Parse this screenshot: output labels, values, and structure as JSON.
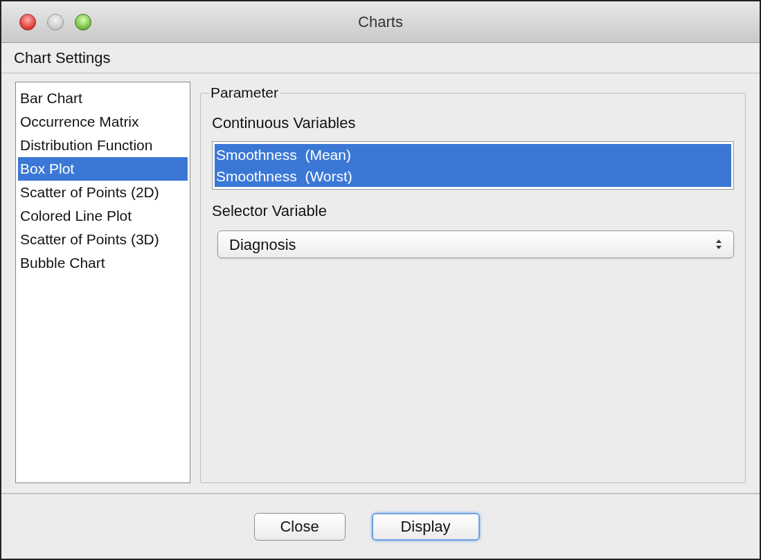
{
  "window": {
    "title": "Charts"
  },
  "header": "Chart Settings",
  "chart_types": [
    {
      "label": "Bar Chart",
      "selected": false
    },
    {
      "label": "Occurrence Matrix",
      "selected": false
    },
    {
      "label": "Distribution Function",
      "selected": false
    },
    {
      "label": "Box Plot",
      "selected": true
    },
    {
      "label": "Scatter of Points (2D)",
      "selected": false
    },
    {
      "label": "Colored Line Plot",
      "selected": false
    },
    {
      "label": "Scatter of Points (3D)",
      "selected": false
    },
    {
      "label": "Bubble Chart",
      "selected": false
    }
  ],
  "parameter": {
    "title": "Parameter",
    "continuous_label": "Continuous Variables",
    "continuous_items": [
      {
        "label": "Smoothness  (Mean)",
        "selected": true
      },
      {
        "label": "Smoothness  (Worst)",
        "selected": true
      }
    ],
    "selector_label": "Selector Variable",
    "selector_value": "Diagnosis"
  },
  "buttons": [
    {
      "label": "Close",
      "focused": false
    },
    {
      "label": "Display",
      "focused": true
    }
  ]
}
